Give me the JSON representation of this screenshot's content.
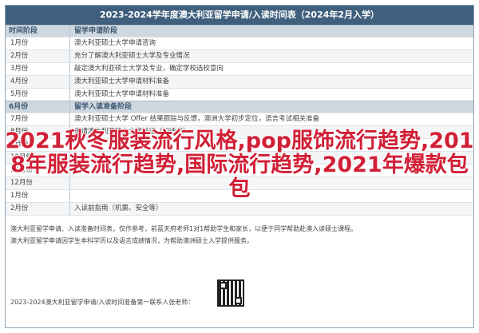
{
  "document": {
    "title": "2023-2024学年度澳大利亚留学申请/入读时间表（2024年2月入学）"
  },
  "sections": [
    {
      "time_label": "时间阶段",
      "stage_label": "留学申请阶段",
      "rows": [
        {
          "date": "1月份",
          "event": "澳大利亚硕士大学申请咨询"
        },
        {
          "date": "2月份",
          "event": "充分了解澳大利亚硕士大学及专业情况"
        },
        {
          "date": "3月份",
          "event": "敲定澳大利亚硕士大学及专业，确定学校选校意向"
        },
        {
          "date": "4月份",
          "event": "澳大利亚硕士大学申请材料准备"
        },
        {
          "date": "5月份",
          "event": "澳大利亚硕士大学申请材料准备"
        }
      ]
    },
    {
      "time_label": "6月份",
      "stage_label": "留学入读准备阶段",
      "rows": [
        {
          "date": "7月份",
          "event": "澳大利亚硕士大学 Offer 结果跟踪与反馈，澳洲大学初步定位，语言考试相关准备"
        },
        {
          "date": "8月份",
          "event": "申请澳大利亚硕士大学签证（如适用）"
        },
        {
          "date": "9月份",
          "event": ""
        },
        {
          "date": "10月份",
          "event": ""
        },
        {
          "date": "11月份",
          "event": ""
        },
        {
          "date": "12月份",
          "event": ""
        },
        {
          "date": "1月份",
          "event": ""
        },
        {
          "date": "2月份",
          "event": "入读前指南（机票、安全等）"
        }
      ]
    }
  ],
  "info_lines": [
    "澳大利亚留学申请、入读准备时间表，仅作参考，前蓝天府老师1对1帮助学生和家长，以便于同学帮助赴澳入读硕士课程。",
    "澳大利亚留学申请因学生本科学历以及语言成绩情况，为帮助澳洲硕士入学提供服务。"
  ],
  "footer": {
    "title": "2023-2024澳大利亚留学申请/入读时间准备第一联系人张老师："
  },
  "overlay": {
    "text": "2021秋冬服装流行风格,pop服饰流行趋势,2018年服装流行趋势,国际流行趋势,2021年爆款包包"
  }
}
